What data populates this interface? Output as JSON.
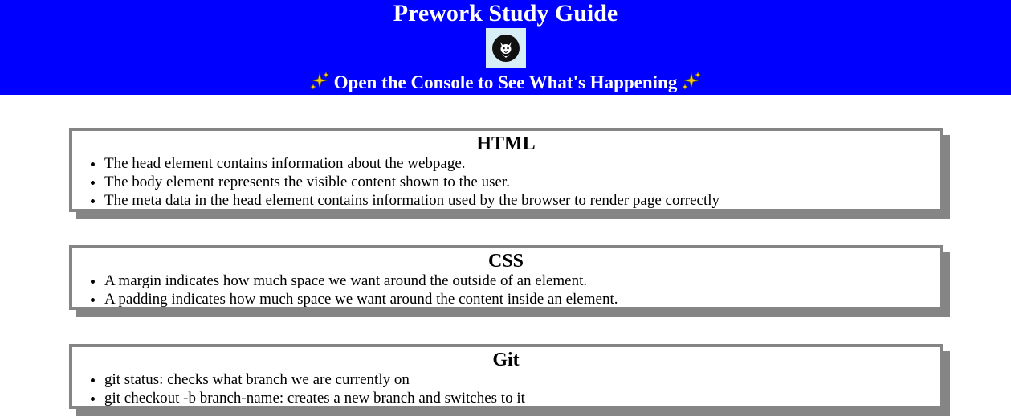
{
  "header": {
    "title": "Prework Study Guide",
    "subtitle": "Open the Console to See What's Happening",
    "background_color": "#0000ff",
    "logo_icon": "cat-logo-icon",
    "sparkle_icon": "sparkles-emoji"
  },
  "sections": [
    {
      "heading": "HTML",
      "items": [
        "The head element contains information about the webpage.",
        "The body element represents the visible content shown to the user.",
        "The meta data in the head element contains information used by the browser to render page correctly"
      ]
    },
    {
      "heading": "CSS",
      "items": [
        "A margin indicates how much space we want around the outside of an element.",
        "A padding indicates how much space we want around the content inside an element."
      ]
    },
    {
      "heading": "Git",
      "items": [
        "git status: checks what branch we are currently on",
        "git checkout -b branch-name: creates a new branch and switches to it"
      ]
    }
  ]
}
